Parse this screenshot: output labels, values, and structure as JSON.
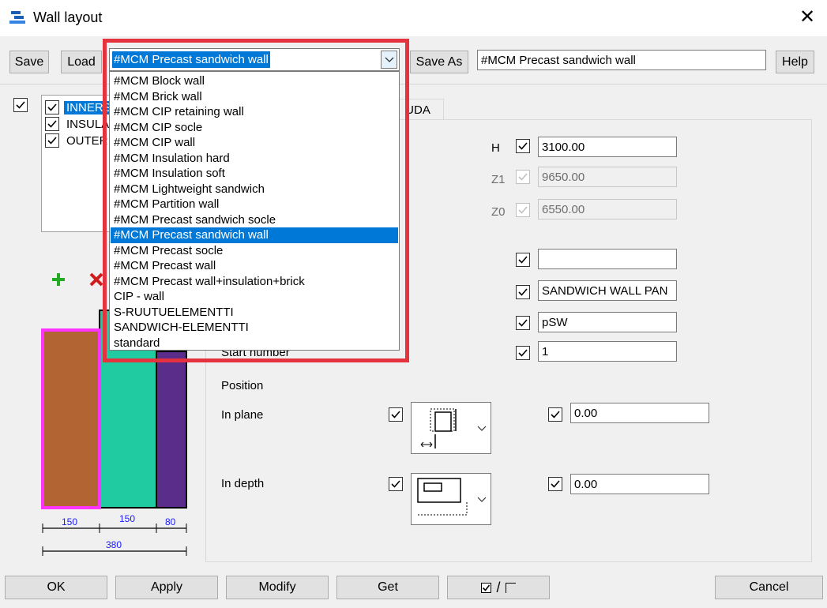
{
  "window": {
    "title": "Wall layout",
    "close_glyph": "✕"
  },
  "toolbar": {
    "save": "Save",
    "load": "Load",
    "save_as": "Save As",
    "save_as_name": "#MCM Precast sandwich wall",
    "help": "Help"
  },
  "preset_combo": {
    "selected": "#MCM Precast sandwich wall",
    "options": [
      "#MCM Block wall",
      "#MCM Brick wall",
      "#MCM CIP retaining wall",
      "#MCM CIP socle",
      "#MCM CIP wall",
      "#MCM Insulation hard",
      "#MCM Insulation soft",
      "#MCM Lightweight sandwich",
      "#MCM Partition wall",
      "#MCM Precast sandwich socle",
      "#MCM Precast sandwich wall",
      "#MCM Precast socle",
      "#MCM Precast wall",
      "#MCM Precast wall+insulation+brick",
      "CIP - wall",
      "S-RUUTUELEMENTTI",
      "SANDWICH-ELEMENTTI",
      "standard"
    ],
    "selected_index": 10
  },
  "layers": [
    {
      "label": "INNERS",
      "checked": true,
      "selected": true
    },
    {
      "label": "INSULA",
      "checked": true,
      "selected": false
    },
    {
      "label": "OUTER",
      "checked": true,
      "selected": false
    }
  ],
  "tabs": {
    "uda": "UDA"
  },
  "fields": {
    "h_label": "H",
    "h_value": "3100.00",
    "z1_label": "Z1",
    "z1_value": "9650.00",
    "z0_label": "Z0",
    "z0_value": "6550.00",
    "field4_value": "",
    "field5_value": "SANDWICH WALL PAN",
    "field6_value": "pSW",
    "start_number_label": "Start number",
    "start_number_value": "1"
  },
  "position": {
    "title": "Position",
    "in_plane_label": "In plane",
    "in_plane_value": "0.00",
    "in_depth_label": "In depth",
    "in_depth_value": "0.00"
  },
  "diagram": {
    "layer_widths": [
      "150",
      "150",
      "80"
    ],
    "total_width": "380",
    "colors": {
      "inner": "#b26432",
      "insulation": "#21cba1",
      "outer": "#5b2d8a",
      "selected_border": "#ff33ff"
    }
  },
  "footer": {
    "ok": "OK",
    "apply": "Apply",
    "modify": "Modify",
    "get": "Get",
    "toggle_slash": "/",
    "cancel": "Cancel"
  }
}
